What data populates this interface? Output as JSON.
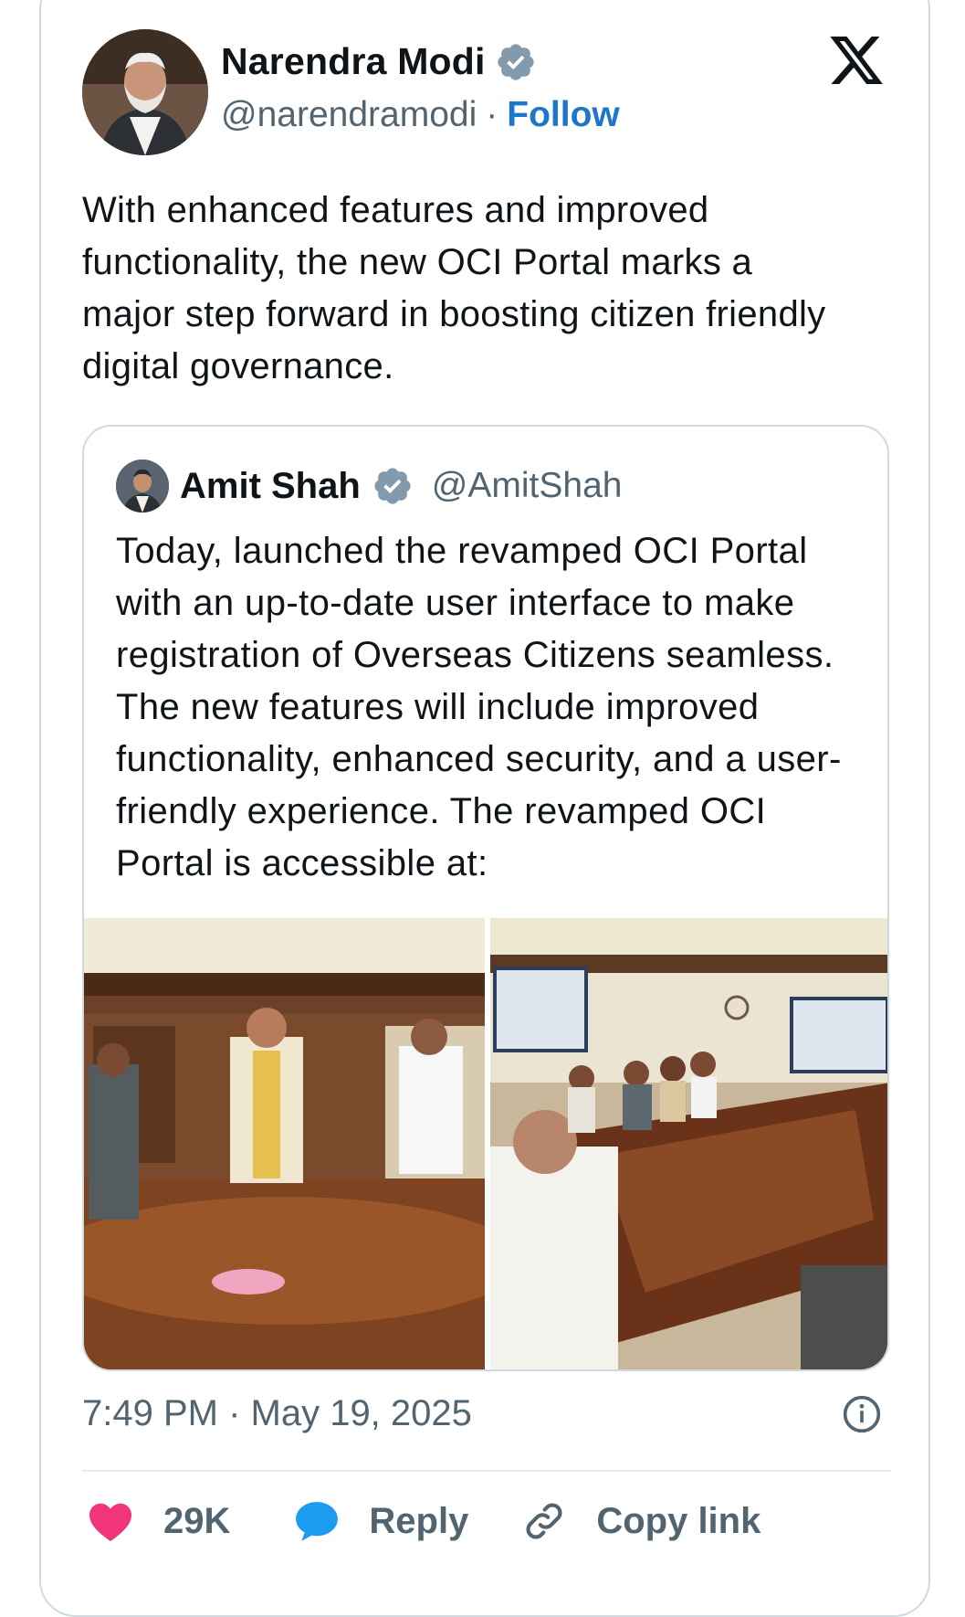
{
  "tweet": {
    "author_name": "Narendra Modi",
    "author_handle": "@narendramodi",
    "separator": "·",
    "follow_label": "Follow",
    "text": "With enhanced features and improved functionality, the new OCI Portal marks a major step forward in boosting citizen friendly digital governance.",
    "timestamp": "7:49 PM · May 19, 2025"
  },
  "quote": {
    "author_name": "Amit Shah",
    "author_handle": "@AmitShah",
    "text": "Today, launched the revamped OCI Portal with an up-to-date user interface to make registration of Overseas Citizens seamless. The new features will include improved functionality, enhanced security, and a user-friendly experience. The revamped OCI Portal is accessible at:"
  },
  "actions": {
    "like_count": "29K",
    "reply_label": "Reply",
    "copy_label": "Copy link"
  },
  "icons": {
    "verified": "verified-badge-icon",
    "x_logo": "x-logo-icon",
    "info": "info-icon",
    "heart": "heart-icon",
    "reply": "reply-bubble-icon",
    "link": "link-icon"
  },
  "colors": {
    "follow": "#1d76c9",
    "heart": "#f0357a",
    "reply": "#1d9bf0",
    "muted": "#536471",
    "verified": "#829aab"
  }
}
